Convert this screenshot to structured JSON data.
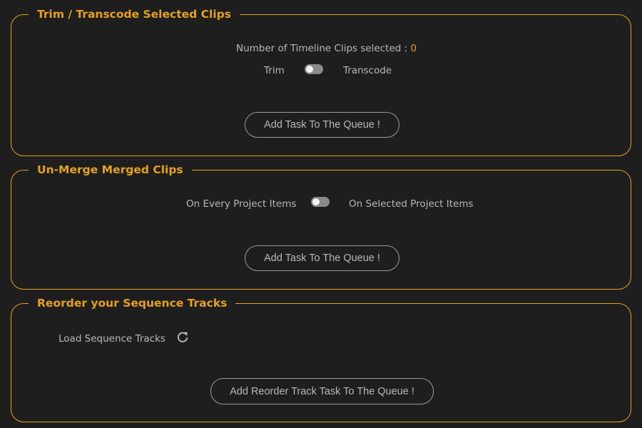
{
  "trim_panel": {
    "title": "Trim / Transcode Selected Clips",
    "clips_selected_label": "Number of Timeline Clips selected :",
    "clips_selected_count": "0",
    "toggle_left_label": "Trim",
    "toggle_right_label": "Transcode",
    "toggle_state": "off",
    "button_label": "Add Task To The Queue !"
  },
  "unmerge_panel": {
    "title": "Un-Merge Merged Clips",
    "toggle_left_label": "On Every Project Items",
    "toggle_right_label": "On Selected Project Items",
    "toggle_state": "off",
    "button_label": "Add Task To The Queue !"
  },
  "reorder_panel": {
    "title": "Reorder your Sequence Tracks",
    "load_label": "Load Sequence Tracks",
    "refresh_icon": "refresh-icon",
    "button_label": "Add Reorder Track Task To The Queue !"
  },
  "colors": {
    "accent": "#e6a11e",
    "background": "#1e1e1e",
    "text": "#b8b8b8",
    "toggle_track": "#8a8a8a"
  }
}
